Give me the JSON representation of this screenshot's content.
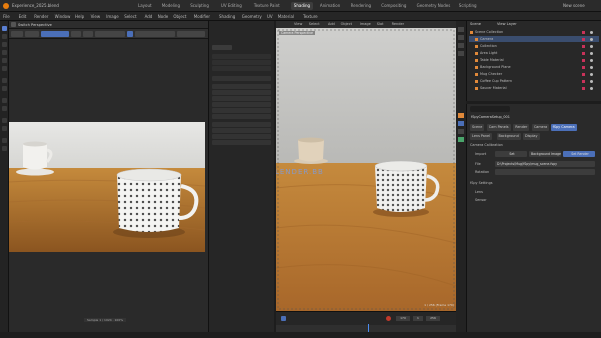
{
  "titlebar": {
    "file_label": "Experience_2025.blend",
    "workspace_tabs": [
      "Layout",
      "Modeling",
      "Sculpting",
      "UV Editing",
      "Texture Paint",
      "Shading",
      "Animation",
      "Rendering",
      "Compositing",
      "Geometry Nodes",
      "Scripting"
    ],
    "active_tab": "Shading",
    "right_label": "New scene",
    "scene_label": "Scene"
  },
  "menubar": {
    "items": [
      "File",
      "Edit",
      "Render",
      "Window",
      "Help",
      "View",
      "Image",
      "Select",
      "Add",
      "Node",
      "Object",
      "Modifier",
      "Shading",
      "Geometry",
      "UV",
      "Material",
      "Texture"
    ]
  },
  "image_editor": {
    "header_label": "Switch Perspective",
    "bottom_info": "Sample 1 / 1024 · 100%"
  },
  "viewport": {
    "header_items": [
      "View",
      "Select",
      "Add",
      "Object",
      "Image",
      "Slot",
      "Render"
    ],
    "overlay_label": "Camera Perspective",
    "watermark": "WWW.BLENDER.BB",
    "frame_info": "1 / 256 (Frame 170)"
  },
  "timeline": {
    "frame": "170",
    "start": "1",
    "end": "256"
  },
  "outliner": {
    "title": "Scene",
    "view_layer": "View Layer",
    "items": [
      {
        "label": "Scene Collection"
      },
      {
        "label": "Camera"
      },
      {
        "label": "Collection"
      },
      {
        "label": "Area Light"
      },
      {
        "label": "Table Material"
      },
      {
        "label": "Background Plane"
      },
      {
        "label": "Mug Checker"
      },
      {
        "label": "Coffee Cup Pattern"
      },
      {
        "label": "Saucer Material"
      }
    ]
  },
  "properties": {
    "object_label": "fSpyCameraSetup_001",
    "search_placeholder": "Search",
    "tabs": [
      "Scene",
      "Cam Panels",
      "Render",
      "Camera",
      "fSpy Camera"
    ],
    "active_tab": "fSpy Camera",
    "tabs2": [
      "Lens Panel",
      "Background",
      "Display"
    ],
    "section_camera": "Camera Calibration",
    "field_file_label": "File",
    "field_file_value": "D:\\Projects\\Mug\\fSpy\\mug_scene.fspy",
    "field_import_label": "Import",
    "import_options": [
      "Set",
      "Background Image",
      "Set Render"
    ],
    "field_rotation": "Rotation",
    "section_vanish": "fSpy Settings",
    "subsections": [
      "Lens",
      "Sensor"
    ]
  },
  "colors": {
    "accent": "#4b6fb8",
    "bg": "#1d1d1d",
    "panel": "#2a2a2a"
  }
}
